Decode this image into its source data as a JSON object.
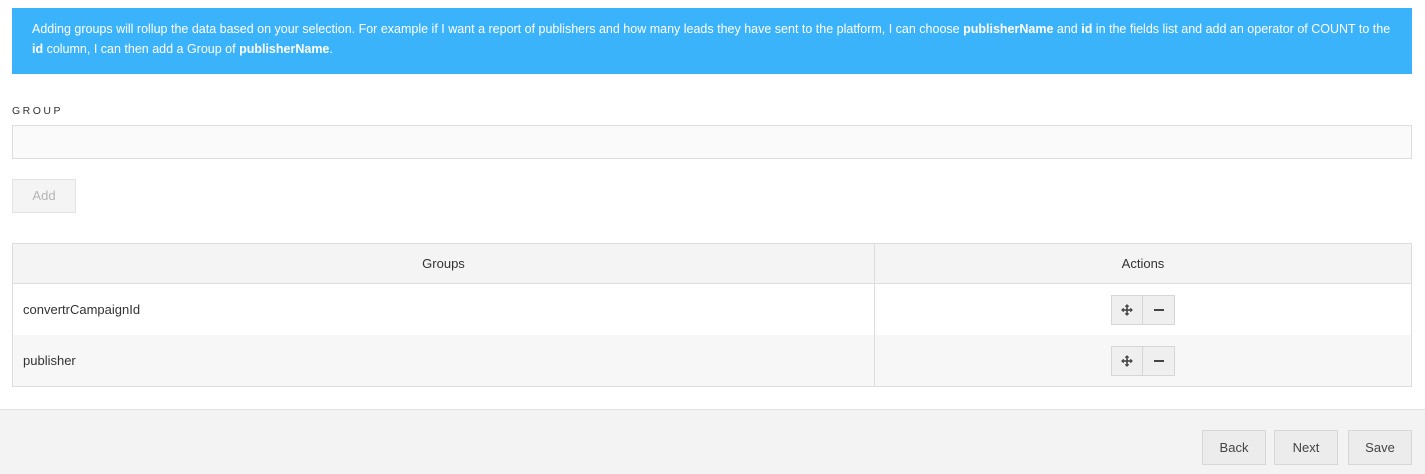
{
  "info_banner": {
    "text_1": "Adding groups will rollup the data based on your selection. For example if I want a report of publishers and how many leads they have sent to the platform, I can choose ",
    "bold_1": "publisherName",
    "text_2": " and ",
    "bold_2": "id",
    "text_3": " in the fields list and add an operator of COUNT to the ",
    "bold_3": "id",
    "text_4": " column, I can then add a Group of ",
    "bold_4": "publisherName",
    "text_5": "."
  },
  "group_form": {
    "label": "GROUP",
    "input_value": "",
    "add_label": "Add"
  },
  "table": {
    "headers": [
      "Groups",
      "Actions"
    ],
    "rows": [
      {
        "group": "convertrCampaignId",
        "actions": [
          "move-icon",
          "remove-icon"
        ]
      },
      {
        "group": "publisher",
        "actions": [
          "move-icon",
          "remove-icon"
        ]
      }
    ]
  },
  "footer": {
    "back_label": "Back",
    "next_label": "Next",
    "save_label": "Save"
  },
  "colors": {
    "banner_bg": "#3bb3fb",
    "banner_text": "#ffffff"
  }
}
